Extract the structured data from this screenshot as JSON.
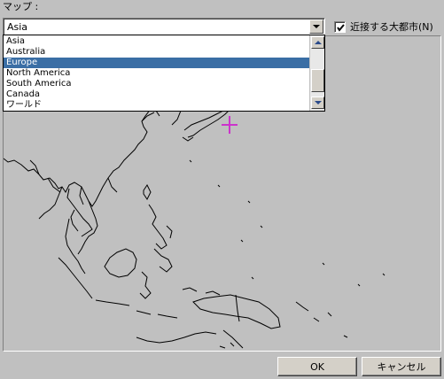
{
  "map_label": "マップ :",
  "combo": {
    "value": "Asia"
  },
  "dropdown": {
    "items": [
      "Asia",
      "Australia",
      "Europe",
      "North America",
      "South America",
      "Canada",
      "ワールド"
    ],
    "selected": "Europe"
  },
  "checkbox": {
    "label": "近接する大都市(N)",
    "checked": true
  },
  "buttons": {
    "ok": "OK",
    "cancel": "キャンセル"
  },
  "map": {
    "marker": "crosshair-magenta",
    "marker_color": "#cc33cc"
  }
}
